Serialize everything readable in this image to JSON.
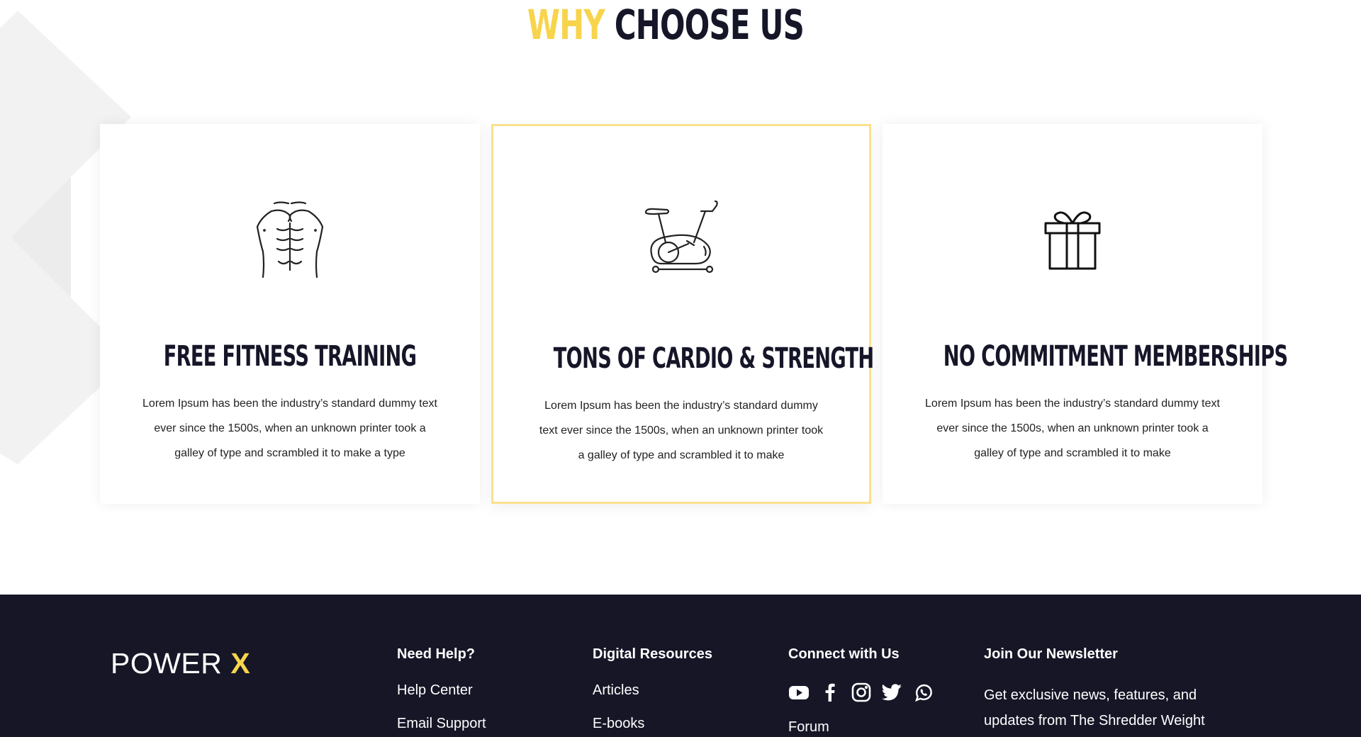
{
  "section": {
    "title_accent": "WHY",
    "title_main": "CHOOSE US"
  },
  "cards": [
    {
      "icon": "abs-icon",
      "title": "FREE FITNESS TRAINING",
      "text": "Lorem Ipsum has been the industry’s standard dummy text ever since the 1500s, when an unknown printer took a galley of type and scrambled it to make a type"
    },
    {
      "icon": "exercise-bike-icon",
      "title": "TONS OF CARDIO & STRENGTH",
      "text": "Lorem Ipsum has been the industry’s standard dummy text ever since the 1500s, when an unknown printer took a galley of type and scrambled it to make"
    },
    {
      "icon": "gift-icon",
      "title": "NO COMMITMENT MEMBERSHIPS",
      "text": "Lorem Ipsum has been the industry’s standard dummy text ever since the 1500s, when an unknown printer took a galley of type and scrambled it to make"
    }
  ],
  "footer": {
    "logo_text": "POWER",
    "logo_accent": "X",
    "need_help": {
      "heading": "Need Help?",
      "links": [
        "Help Center",
        "Email Support"
      ]
    },
    "digital_resources": {
      "heading": "Digital Resources",
      "links": [
        "Articles",
        "E-books"
      ]
    },
    "connect": {
      "heading": "Connect with Us",
      "icons": [
        "youtube-icon",
        "facebook-icon",
        "instagram-icon",
        "twitter-icon",
        "whatsapp-icon"
      ],
      "links": [
        "Forum"
      ]
    },
    "newsletter": {
      "heading": "Join Our Newsletter",
      "text": "Get exclusive news, features, and updates from The Shredder Weight"
    }
  },
  "colors": {
    "accent": "#f7d44c",
    "dark": "#161627",
    "card_border_active": "#fbe08d"
  }
}
